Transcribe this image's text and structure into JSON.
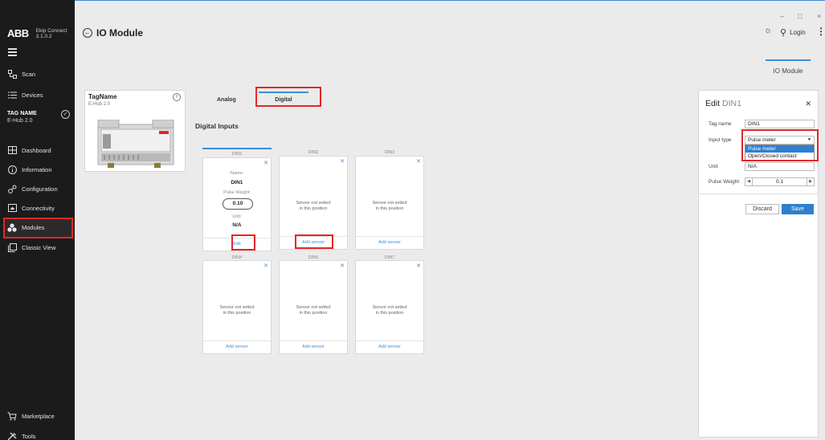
{
  "window": {
    "minimize": "–",
    "maximize": "□",
    "close": "×"
  },
  "sidebar": {
    "brand": "ABB",
    "app_name": "Ekip Connect",
    "app_version": "3.1.0.2",
    "scan": "Scan",
    "devices": "Devices",
    "tag_name": "TAG NAME",
    "tag_model": "E-Hub 2.0",
    "dashboard": "Dashboard",
    "information": "Information",
    "configuration": "Configuration",
    "connectivity": "Connectivity",
    "modules": "Modules",
    "classic_view": "Classic View",
    "marketplace": "Marketplace",
    "tools": "Tools"
  },
  "header": {
    "title": "IO Module",
    "login": "Login",
    "active_tab": "IO Module"
  },
  "device_card": {
    "name": "TagName",
    "model": "E-Hub 2.0"
  },
  "tabs": {
    "analog": "Analog",
    "digital": "Digital"
  },
  "section_title": "Digital Inputs",
  "slots": [
    {
      "label": "DIN1",
      "name_label": "Name:",
      "name": "DIN1",
      "weight_label": "Pulse Weight:",
      "weight": "0.10",
      "unit_label": "Unit:",
      "unit": "N/A",
      "action": "Edit"
    },
    {
      "label": "DIN2",
      "empty_line1": "Sensor not setted",
      "empty_line2": "in this position",
      "action": "Add sensor"
    },
    {
      "label": "DIN3",
      "empty_line1": "Sensor not setted",
      "empty_line2": "in this position",
      "action": "Add sensor"
    },
    {
      "label": "DIN4",
      "empty_line1": "Sensor not setted",
      "empty_line2": "in this position",
      "action": "Add sensor"
    },
    {
      "label": "DIN5",
      "empty_line1": "Sensor not setted",
      "empty_line2": "in this position",
      "action": "Add sensor"
    },
    {
      "label": "DIN7",
      "empty_line1": "Sensor not setted",
      "empty_line2": "in this position",
      "action": "Add sensor"
    }
  ],
  "edit_panel": {
    "title_prefix": "Edit",
    "title_target": "DIN1",
    "tag_name_label": "Tag name",
    "tag_name_value": "DIN1",
    "input_type_label": "Input type",
    "input_type_value": "Pulse meter",
    "input_type_options": [
      "Pulse meter",
      "Open/Closed contact"
    ],
    "unit_label": "Unit",
    "unit_value": "N/A",
    "pulse_weight_label": "Pulse Weight",
    "pulse_weight_value": "0.1",
    "discard": "Discard",
    "save": "Save"
  },
  "colors": {
    "accent": "#2f7fd0",
    "highlight": "#e42528",
    "sidebar": "#1b1b1b"
  }
}
